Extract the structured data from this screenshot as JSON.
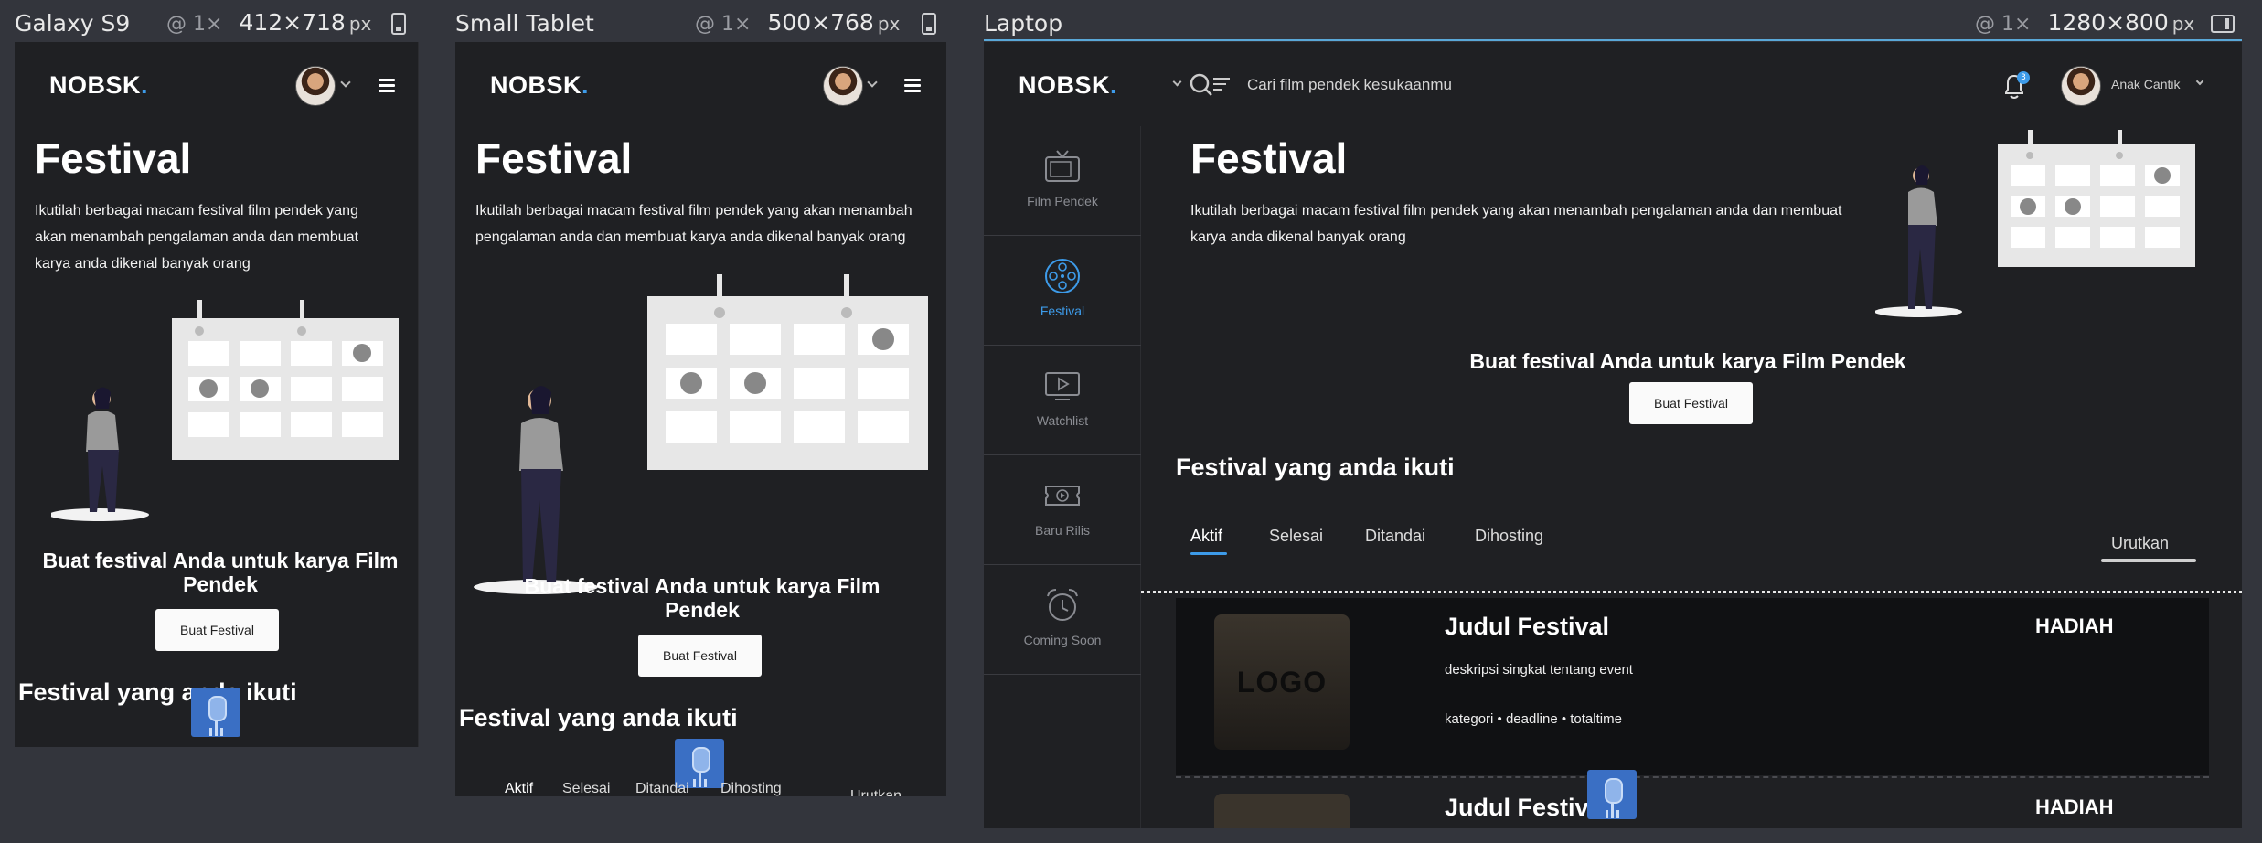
{
  "devices": [
    {
      "name": "Galaxy S9",
      "zoom": "@ 1×",
      "width": "412",
      "height": "718",
      "unit": "px"
    },
    {
      "name": "Small Tablet",
      "zoom": "@ 1×",
      "width": "500",
      "height": "768",
      "unit": "px"
    },
    {
      "name": "Laptop",
      "zoom": "@ 1×",
      "width": "1280",
      "height": "800",
      "unit": "px"
    }
  ],
  "brand": {
    "logo_text": "NOBSK",
    "logo_dot": ".",
    "accent": "#3d9be9"
  },
  "page": {
    "title": "Festival",
    "description": "Ikutilah berbagai macam festival film pendek yang akan menambah pengalaman anda dan membuat karya anda dikenal banyak orang",
    "cta_heading": "Buat festival Anda untuk karya Film Pendek",
    "cta_button": "Buat Festival",
    "section_title": "Festival yang anda ikuti",
    "tabs": [
      "Aktif",
      "Selesai",
      "Ditandai",
      "Dihosting"
    ],
    "sort_label": "Urutkan"
  },
  "laptop": {
    "search_placeholder": "Cari film pendek kesukaanmu",
    "notification_count": "3",
    "user_name": "Anak Cantik",
    "sidebar": [
      {
        "label": "Film Pendek",
        "icon": "tv-icon"
      },
      {
        "label": "Festival",
        "icon": "film-reel-icon"
      },
      {
        "label": "Watchlist",
        "icon": "play-screen-icon"
      },
      {
        "label": "Baru Rilis",
        "icon": "ticket-play-icon"
      },
      {
        "label": "Coming Soon",
        "icon": "alarm-clock-icon"
      }
    ],
    "festival_cards": [
      {
        "logo": "LOGO",
        "title": "Judul Festival",
        "description": "deskripsi singkat tentang event",
        "meta": "kategori • deadline • totaltime",
        "prize": "HADIAH"
      },
      {
        "title": "Judul Festival",
        "prize": "HADIAH"
      }
    ]
  }
}
